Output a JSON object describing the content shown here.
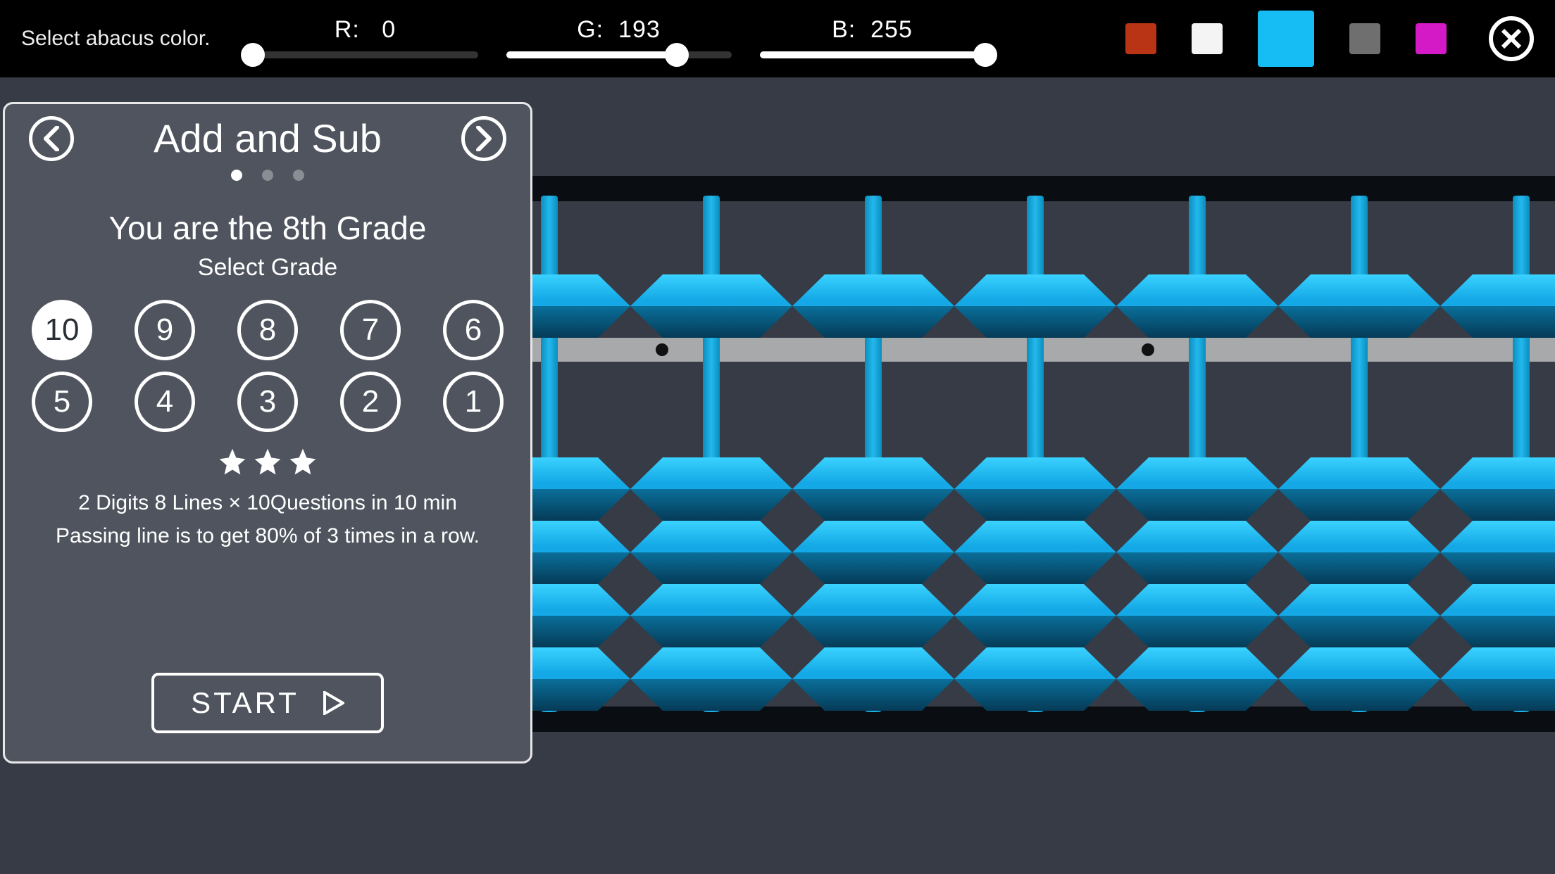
{
  "topbar": {
    "hint": "Select abacus color.",
    "rgb": {
      "r": {
        "label": "R:",
        "value": 0,
        "pct": 0
      },
      "g": {
        "label": "G:",
        "value": 193,
        "pct": 75.7
      },
      "b": {
        "label": "B:",
        "value": 255,
        "pct": 100
      }
    },
    "swatches": [
      {
        "name": "swatch-red",
        "color": "#b83414",
        "active": false
      },
      {
        "name": "swatch-white",
        "color": "#f4f4f4",
        "active": false
      },
      {
        "name": "swatch-cyan",
        "color": "#16bcf4",
        "active": true
      },
      {
        "name": "swatch-gray",
        "color": "#6f6f6f",
        "active": false
      },
      {
        "name": "swatch-magenta",
        "color": "#d41ac6",
        "active": false
      }
    ]
  },
  "panel": {
    "title": "Add and Sub",
    "page_dots": 3,
    "active_dot": 0,
    "grade_title": "You are the 8th Grade",
    "grade_sub": "Select  Grade",
    "grades": [
      "10",
      "9",
      "8",
      "7",
      "6",
      "5",
      "4",
      "3",
      "2",
      "1"
    ],
    "selected_grade_index": 0,
    "star_count": 3,
    "desc_line1": "2 Digits  8 Lines × 10Questions  in  10 min",
    "desc_line2": "Passing line is to get 80% of 3 times in a row.",
    "start_label": "START"
  },
  "abacus": {
    "rods": 7,
    "rod_spacing": 230,
    "rod_start": 80,
    "dot_positions": [
      240,
      930
    ],
    "bead_color": "#16bcf4"
  }
}
